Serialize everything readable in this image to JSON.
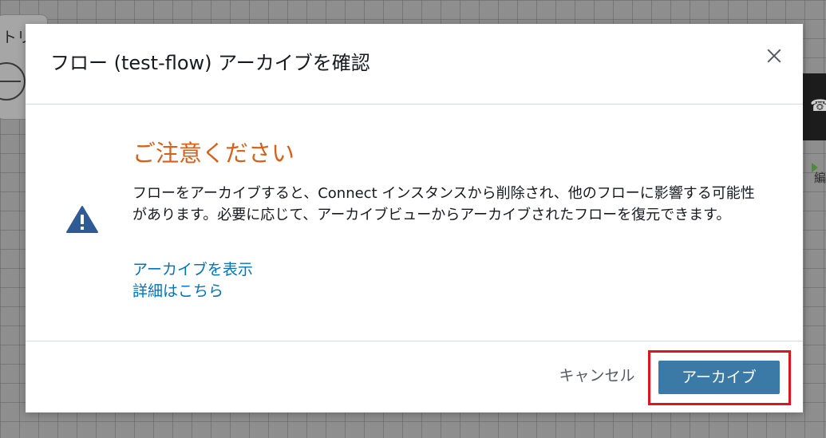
{
  "background": {
    "card_label": "トリ",
    "right_fragment": "編"
  },
  "modal": {
    "title": "フロー (test-flow) アーカイブを確認",
    "warning": {
      "icon": "warning-triangle-icon",
      "heading": "ご注意ください",
      "message": "フローをアーカイブすると、Connect インスタンスから削除され、他のフローに影響する可能性があります。必要に応じて、アーカイブビューからアーカイブされたフローを復元できます。"
    },
    "links": {
      "view_archive": "アーカイブを表示",
      "learn_more": "詳細はこちら"
    },
    "footer": {
      "cancel_label": "キャンセル",
      "archive_label": "アーカイブ"
    }
  },
  "colors": {
    "warning_heading": "#d5611b",
    "warning_icon": "#2f5a94",
    "link": "#0073bb",
    "primary_button": "#3b7aa6",
    "highlight": "#e0141e"
  }
}
